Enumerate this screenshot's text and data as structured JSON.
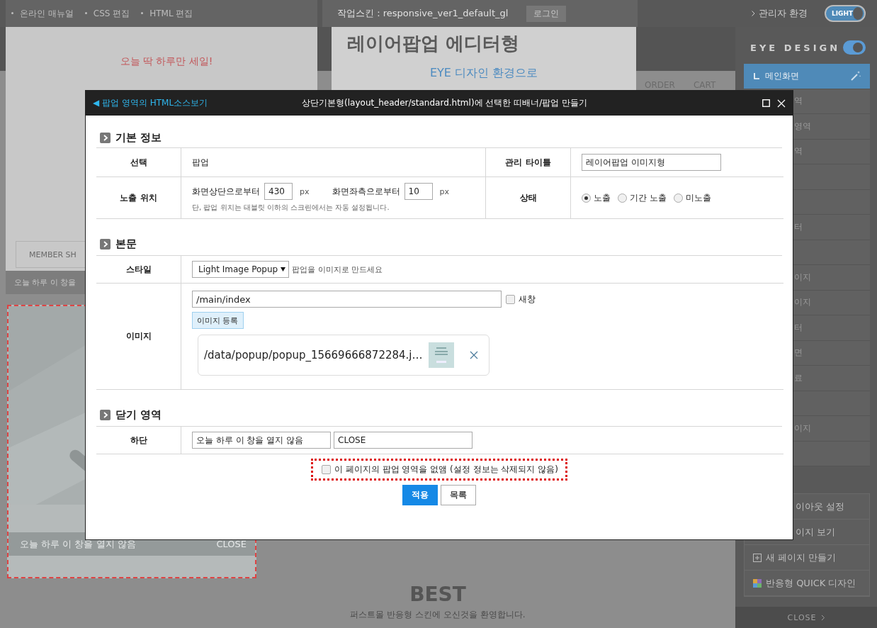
{
  "top_bar": {
    "menu": [
      {
        "label": "온라인 매뉴얼"
      },
      {
        "label": "CSS 편집"
      },
      {
        "label": "HTML 편집"
      }
    ],
    "skin_label": "작업스킨 : responsive_ver1_default_gl",
    "login_button": "로그인",
    "admin_link": "관리자 환경",
    "theme_toggle": {
      "label": "LIGHT",
      "on": true
    }
  },
  "preview": {
    "sale_text": "오늘 딱 하루만 세일!",
    "member_button": "MEMBER SH",
    "bar_text": "오늘 하루 이 창을",
    "popup": {
      "kind": "picture",
      "footer_left": "오늘 하루 이 창을 열지 않음",
      "footer_right": "CLOSE"
    }
  },
  "editor_panel": {
    "title": "레이어팝업 에디터형",
    "subtitle": "EYE 디자인 환경으로"
  },
  "nav": [
    {
      "label": "ORDER"
    },
    {
      "label": "CART"
    }
  ],
  "page_section": {
    "title": "BEST",
    "subtitle": "퍼스트몰 반응형 스킨에 오신것을 환영합니다."
  },
  "sidebar": {
    "title": "EYE DESIGN",
    "toggle_on": true,
    "items": [
      {
        "label": "메인화면",
        "selected": true
      },
      {
        "label": "역",
        "selected": false
      },
      {
        "label": "영역",
        "selected": false
      },
      {
        "label": "역",
        "selected": false
      },
      {
        "selected": false
      },
      {
        "selected": false
      },
      {
        "label": "터",
        "selected": false
      },
      {
        "selected": false
      },
      {
        "label": "이지",
        "selected": false
      },
      {
        "label": "이지",
        "selected": false
      },
      {
        "label": "터",
        "selected": false
      },
      {
        "label": "면",
        "selected": false
      },
      {
        "label": "료",
        "selected": false
      },
      {
        "selected": false
      },
      {
        "label": "이지",
        "selected": false
      },
      {
        "selected": false
      }
    ],
    "actions": [
      {
        "label": "이아웃 설정",
        "kind": "plain"
      },
      {
        "label": "이지 보기",
        "kind": "plain"
      },
      {
        "label": "새 페이지 만들기",
        "kind": "plus"
      },
      {
        "label": "반응형 QUICK 디자인",
        "kind": "palette"
      }
    ],
    "close": "CLOSE"
  },
  "modal": {
    "back_link": "◀ 팝업 영역의 HTML소스보기",
    "title": "상단기본형(layout_header/standard.html)에 선택한 띠배너/팝업 만들기",
    "basic_info": {
      "heading": "기본 정보",
      "select_label": "선택",
      "select_value": "팝업",
      "admin_title_label": "관리 타이틀",
      "admin_title_value": "레이어팝업 이미지형",
      "position_label": "노출 위치",
      "top_label": "화면상단으로부터",
      "top_value": "430",
      "top_unit": "px",
      "left_label": "화면좌측으로부터",
      "left_value": "10",
      "left_unit": "px",
      "note": "단, 팝업 위치는 태블릿 이하의 스크린에서는 자동 설정됩니다.",
      "status_label": "상태",
      "status_options": [
        {
          "label": "노출",
          "selected": true
        },
        {
          "label": "기간 노출",
          "selected": false
        },
        {
          "label": "미노출",
          "selected": false
        }
      ]
    },
    "body": {
      "heading": "본문",
      "style_label": "스타일",
      "style_value": "Light Image Popup",
      "style_hint": "팝업을 이미지로 만드세요",
      "image_label": "이미지",
      "link_value": "/main/index",
      "new_window": {
        "label": "새창",
        "checked": false
      },
      "upload_button": "이미지 등록",
      "file": {
        "name": "/data/popup/popup_15669666872284.j…"
      }
    },
    "close_area": {
      "heading": "닫기 영역",
      "bottom_label": "하단",
      "left_text": "오늘 하루 이 창을 열지 않음",
      "right_text": "CLOSE"
    },
    "hide_option": {
      "label": "이 페이지의 팝업 영역을 없앰 (설정 정보는 삭제되지 않음)",
      "checked": false
    },
    "buttons": [
      {
        "label": "적용",
        "kind": "primary"
      },
      {
        "label": "목록",
        "kind": "secondary"
      }
    ]
  }
}
